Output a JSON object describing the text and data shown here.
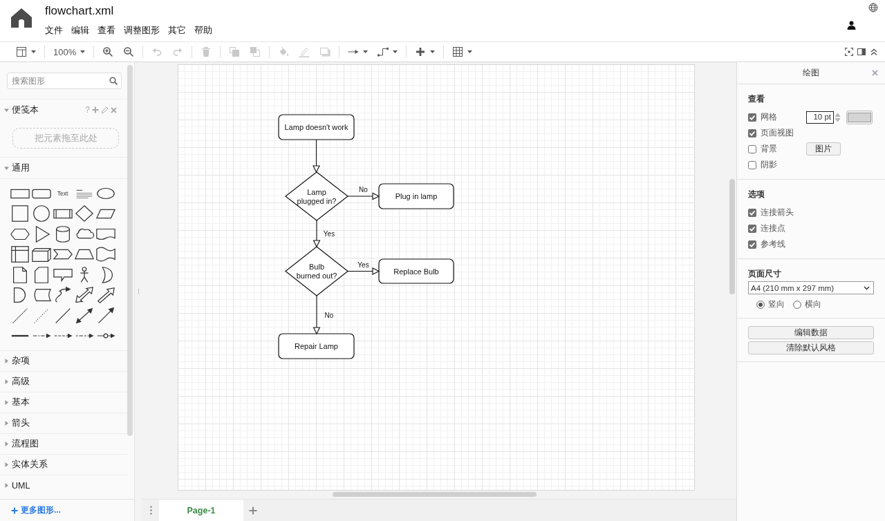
{
  "window": {
    "title": "flowchart.xml"
  },
  "menu": [
    "文件",
    "编辑",
    "查看",
    "调整图形",
    "其它",
    "帮助"
  ],
  "toolbar": {
    "groups": [
      [
        {
          "kind": "layout",
          "disabled": false
        }
      ],
      [
        {
          "kind": "zoom",
          "label": "100%",
          "disabled": false
        }
      ],
      [
        {
          "kind": "zoom-in",
          "disabled": false
        },
        {
          "kind": "zoom-out",
          "disabled": false
        }
      ],
      [
        {
          "kind": "undo",
          "disabled": true
        },
        {
          "kind": "redo",
          "disabled": true
        }
      ],
      [
        {
          "kind": "delete",
          "disabled": true
        }
      ],
      [
        {
          "kind": "to-front",
          "disabled": true
        },
        {
          "kind": "to-back",
          "disabled": true
        }
      ],
      [
        {
          "kind": "fill",
          "disabled": true
        },
        {
          "kind": "line-color",
          "disabled": true
        },
        {
          "kind": "shadow",
          "disabled": true
        }
      ],
      [
        {
          "kind": "connection",
          "disabled": false
        },
        {
          "kind": "waypoints",
          "disabled": false
        }
      ],
      [
        {
          "kind": "insert",
          "disabled": false
        }
      ],
      [
        {
          "kind": "table",
          "disabled": false
        }
      ]
    ]
  },
  "sidebar": {
    "search": {
      "placeholder": "搜索图形"
    },
    "scratchpad": {
      "title": "便笺本",
      "expanded": true,
      "help": "?",
      "drop_hint": "把元素拖至此处"
    },
    "general": {
      "title": "通用",
      "expanded": true,
      "text_item": "Text"
    },
    "sections": [
      {
        "title": "杂项",
        "expanded": false
      },
      {
        "title": "高级",
        "expanded": false
      },
      {
        "title": "基本",
        "expanded": false
      },
      {
        "title": "箭头",
        "expanded": false
      },
      {
        "title": "流程图",
        "expanded": false
      },
      {
        "title": "实体关系",
        "expanded": false
      },
      {
        "title": "UML",
        "expanded": false
      }
    ],
    "more_shapes": "更多图形..."
  },
  "diagram": {
    "nodes": [
      {
        "kind": "process",
        "lines": [
          "Lamp doesn't work"
        ]
      },
      {
        "kind": "decision",
        "lines": [
          "Lamp",
          "plugged in?"
        ]
      },
      {
        "kind": "process",
        "lines": [
          "Plug in lamp"
        ]
      },
      {
        "kind": "decision",
        "lines": [
          "Bulb",
          "burned out?"
        ]
      },
      {
        "kind": "process",
        "lines": [
          "Replace Bulb"
        ]
      },
      {
        "kind": "process",
        "lines": [
          "Repair Lamp"
        ]
      }
    ],
    "edges": [
      {
        "kind": "arrow"
      },
      {
        "kind": "arrow",
        "label": "No"
      },
      {
        "kind": "arrow",
        "label": "Yes"
      },
      {
        "kind": "arrow",
        "label": "Yes"
      },
      {
        "kind": "arrow",
        "label": "No"
      }
    ]
  },
  "pages": [
    {
      "label": "Page-1",
      "selected": true
    }
  ],
  "format_panel": {
    "title": "绘图",
    "view": {
      "title": "查看",
      "items": [
        {
          "kind": "grid",
          "label": "网格",
          "checked": true,
          "value": "10 pt"
        },
        {
          "kind": "plain",
          "label": "页面视图",
          "checked": true
        },
        {
          "kind": "image",
          "label": "背景",
          "checked": false,
          "button": "图片"
        },
        {
          "kind": "plain",
          "label": "阴影",
          "checked": false
        }
      ]
    },
    "options": {
      "title": "选项",
      "items": [
        {
          "label": "连接箭头",
          "checked": true
        },
        {
          "label": "连接点",
          "checked": true
        },
        {
          "label": "参考线",
          "checked": true
        }
      ]
    },
    "page_size": {
      "title": "页面尺寸",
      "value": "A4 (210 mm x 297 mm)",
      "orientations": [
        {
          "label": "竖向",
          "selected": true
        },
        {
          "label": "横向",
          "selected": false
        }
      ]
    },
    "actions": [
      "编辑数据",
      "清除默认风格"
    ]
  }
}
